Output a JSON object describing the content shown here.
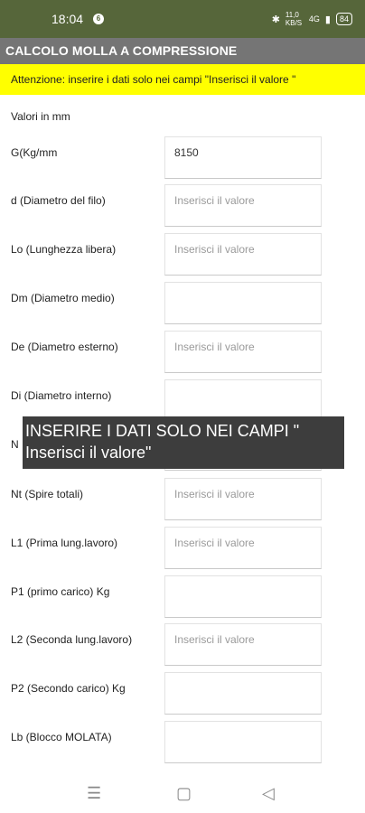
{
  "status": {
    "time": "18:04",
    "app_icon": "6",
    "net": "11,0 KB/S",
    "signal": "4G",
    "battery": "84"
  },
  "app_bar": {
    "title": "CALCOLO MOLLA A COMPRESSIONE"
  },
  "warning": {
    "text": "Attenzione: inserire i dati solo nei campi \"Inserisci il valore \""
  },
  "units": "Valori in mm",
  "fields": [
    {
      "label": "G(Kg/mm",
      "value": "8150",
      "placeholder": ""
    },
    {
      "label": "d (Diametro del filo)",
      "value": "",
      "placeholder": "Inserisci il valore"
    },
    {
      "label": "Lo (Lunghezza libera)",
      "value": "",
      "placeholder": "Inserisci il valore"
    },
    {
      "label": "Dm (Diametro medio)",
      "value": "",
      "placeholder": ""
    },
    {
      "label": "De (Diametro esterno)",
      "value": "",
      "placeholder": "Inserisci il valore"
    },
    {
      "label": "Di (Diametro interno)",
      "value": "",
      "placeholder": ""
    },
    {
      "label": "N",
      "value": "",
      "placeholder": ""
    },
    {
      "label": "Nt (Spire totali)",
      "value": "",
      "placeholder": "Inserisci il valore"
    },
    {
      "label": "L1 (Prima lung.lavoro)",
      "value": "",
      "placeholder": "Inserisci il valore"
    },
    {
      "label": "P1 (primo carico) Kg",
      "value": "",
      "placeholder": ""
    },
    {
      "label": "L2 (Seconda lung.lavoro)",
      "value": "",
      "placeholder": "Inserisci il valore"
    },
    {
      "label": "P2 (Secondo carico) Kg",
      "value": "",
      "placeholder": ""
    },
    {
      "label": "Lb (Blocco MOLATA)",
      "value": "",
      "placeholder": ""
    }
  ],
  "toast": {
    "text": "INSERIRE I DATI SOLO NEI CAMPI \" Inserisci il valore\""
  },
  "nav": {
    "recents_icon": "menu-icon",
    "home_icon": "square-icon",
    "back_icon": "triangle-back-icon"
  }
}
